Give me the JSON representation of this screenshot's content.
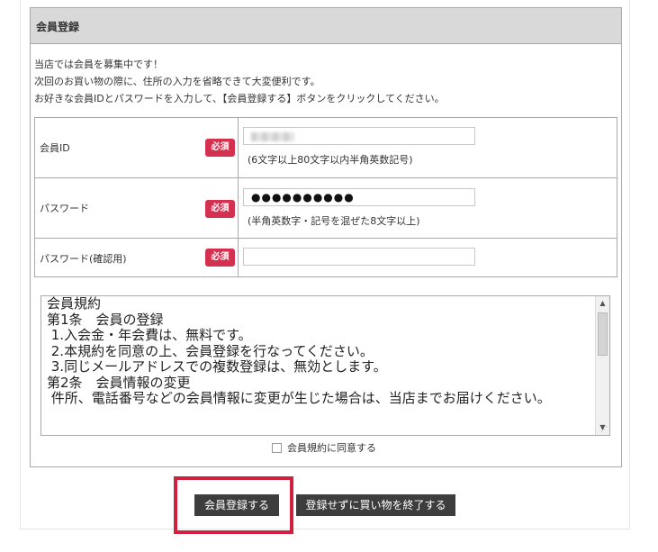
{
  "panel": {
    "title": "会員登録",
    "intro": [
      "当店では会員を募集中です！",
      "次回のお買い物の際に、住所の入力を省略できて大変便利です。",
      "お好きな会員IDとパスワードを入力して、【会員登録する】ボタンをクリックしてください。"
    ]
  },
  "form": {
    "required_badge": "必須",
    "member_id": {
      "label": "会員ID",
      "value": "",
      "hint": "(6文字以上80文字以内半角英数記号)"
    },
    "password": {
      "label": "パスワード",
      "value": "●●●●●●●●●●",
      "hint": "(半角英数字・記号を混ぜた8文字以上)"
    },
    "password_confirm": {
      "label": "パスワード(確認用)",
      "value": ""
    }
  },
  "terms": {
    "lines": [
      "会員規約",
      "",
      "第1条　会員の登録",
      " 1.入会金・年会費は、無料です。",
      " 2.本規約を同意の上、会員登録を行なってください。",
      " 3.同じメールアドレスでの複数登録は、無効とします。",
      "",
      "第2条　会員情報の変更",
      " 件所、電話番号などの会員情報に変更が生じた場合は、当店までお届けください。"
    ],
    "agree_label": "会員規約に同意する",
    "agree_checked": false
  },
  "buttons": {
    "register": "会員登録する",
    "exit": "登録せずに買い物を終了する"
  },
  "colors": {
    "required_badge": "#d4304f",
    "button_bg": "#3d3d3d",
    "highlight_border": "#d0213f",
    "header_bg": "#d9d9d9"
  }
}
